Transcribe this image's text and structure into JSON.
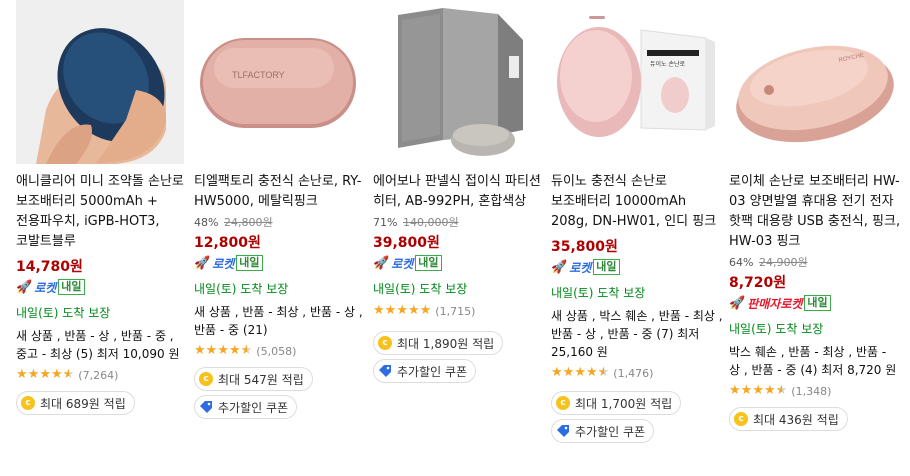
{
  "products": [
    {
      "title": "애니클리어 미니 조약돌 손난로 보조배터리 5000mAh + 전용파우치, iGPB-HOT3, 코발트블루",
      "discount": "",
      "original_price": "",
      "price": "14,780",
      "price_unit": "원",
      "badge": "로켓",
      "badge_type": "rocket",
      "tomorrow": "내일",
      "delivery": "내일(토) 도착 보장",
      "options": "새 상품 , 반품 - 상 , 반품 - 중 , 중고 - 최상 (5) 최저 10,090 원",
      "rating_count": "(7,264)",
      "points": "최대 689원 적립",
      "coupon": ""
    },
    {
      "title": "티엘팩토리 충전식 손난로, RY-HW5000, 메탈릭핑크",
      "discount": "48%",
      "original_price": "24,800원",
      "price": "12,800",
      "price_unit": "원",
      "badge": "로켓",
      "badge_type": "rocket",
      "tomorrow": "내일",
      "delivery": "내일(토) 도착 보장",
      "options": "새 상품 , 반품 - 최상 , 반품 - 상 , 반품 - 중 (21)",
      "rating_count": "(5,058)",
      "points": "최대 547원 적립",
      "coupon": "추가할인 쿠폰"
    },
    {
      "title": "에어보나 판넬식 접이식 파티션 히터, AB-992PH, 혼합색상",
      "discount": "71%",
      "original_price": "140,000원",
      "price": "39,800",
      "price_unit": "원",
      "badge": "로켓",
      "badge_type": "rocket",
      "tomorrow": "내일",
      "delivery": "내일(토) 도착 보장",
      "options": "",
      "rating_count": "(1,715)",
      "points": "최대 1,890원 적립",
      "coupon": "추가할인 쿠폰"
    },
    {
      "title": "듀이노 충전식 손난로 보조배터리 10000mAh 208g, DN-HW01, 인디 핑크",
      "discount": "",
      "original_price": "",
      "price": "35,800",
      "price_unit": "원",
      "badge": "로켓",
      "badge_type": "rocket",
      "tomorrow": "내일",
      "delivery": "내일(토) 도착 보장",
      "options": "새 상품 , 박스 훼손 , 반품 - 최상 , 반품 - 상 , 반품 - 중 (7) 최저 25,160 원",
      "rating_count": "(1,476)",
      "points": "최대 1,700원 적립",
      "coupon": "추가할인 쿠폰"
    },
    {
      "title": "로이체 손난로 보조배터리 HW-03 양면발열 휴대용 전기 전자 핫팩 대용량 USB 충전식, 핑크, HW-03 핑크",
      "discount": "64%",
      "original_price": "24,900원",
      "price": "8,720",
      "price_unit": "원",
      "badge": "판매자로켓",
      "badge_type": "seller",
      "tomorrow": "내일",
      "delivery": "내일(토) 도착 보장",
      "options": "박스 훼손 , 반품 - 최상 , 반품 - 상 , 반품 - 중 (4) 최저 8,720 원",
      "rating_count": "(1,348)",
      "points": "최대 436원 적립",
      "coupon": ""
    }
  ],
  "image_text": {
    "p2_brand": "TLFACTORY",
    "p4_box_title": "듀이노 손난로",
    "p5_brand": "ROYCHE"
  },
  "colors": {
    "price_red": "#ae0000",
    "rocket_blue": "#2d6de1",
    "delivery_green": "#00891a",
    "star": "#f5a623"
  }
}
